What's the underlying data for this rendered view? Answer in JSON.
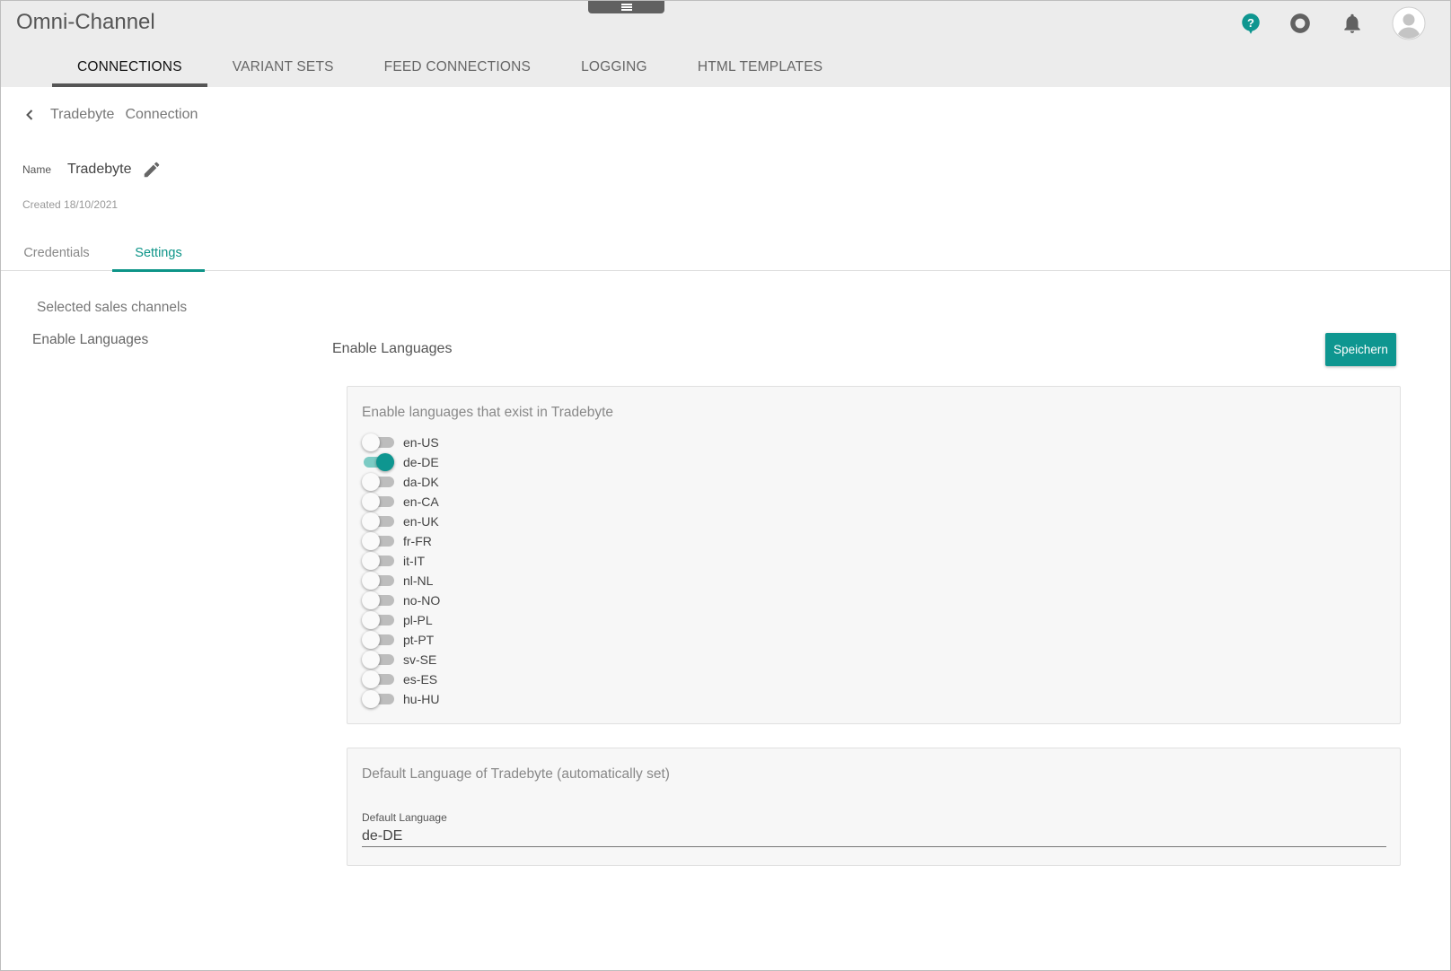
{
  "app": {
    "title": "Omni-Channel"
  },
  "header": {
    "icons": [
      "help-icon",
      "status-icon",
      "bell-icon",
      "avatar"
    ],
    "tabs": [
      {
        "label": "CONNECTIONS",
        "active": true
      },
      {
        "label": "VARIANT SETS",
        "active": false
      },
      {
        "label": "FEED CONNECTIONS",
        "active": false
      },
      {
        "label": "LOGGING",
        "active": false
      },
      {
        "label": "HTML TEMPLATES",
        "active": false
      }
    ]
  },
  "breadcrumb": {
    "items": [
      "Tradebyte",
      "Connection"
    ]
  },
  "record": {
    "name_label": "Name",
    "name_value": "Tradebyte",
    "created": "Created 18/10/2021"
  },
  "subtabs": [
    {
      "label": "Credentials",
      "active": false
    },
    {
      "label": "Settings",
      "active": true
    }
  ],
  "sidenav": {
    "items": [
      {
        "label": "Selected sales channels",
        "active": false
      },
      {
        "label": "Enable Languages",
        "active": true
      }
    ]
  },
  "main": {
    "title": "Enable Languages",
    "save_label": "Speichern",
    "languages_card": {
      "title": "Enable languages that exist in Tradebyte",
      "languages": [
        {
          "code": "en-US",
          "enabled": false
        },
        {
          "code": "de-DE",
          "enabled": true
        },
        {
          "code": "da-DK",
          "enabled": false
        },
        {
          "code": "en-CA",
          "enabled": false
        },
        {
          "code": "en-UK",
          "enabled": false
        },
        {
          "code": "fr-FR",
          "enabled": false
        },
        {
          "code": "it-IT",
          "enabled": false
        },
        {
          "code": "nl-NL",
          "enabled": false
        },
        {
          "code": "no-NO",
          "enabled": false
        },
        {
          "code": "pl-PL",
          "enabled": false
        },
        {
          "code": "pt-PT",
          "enabled": false
        },
        {
          "code": "sv-SE",
          "enabled": false
        },
        {
          "code": "es-ES",
          "enabled": false
        },
        {
          "code": "hu-HU",
          "enabled": false
        }
      ]
    },
    "default_card": {
      "title": "Default Language of Tradebyte (automatically set)",
      "field_label": "Default Language",
      "field_value": "de-DE"
    }
  },
  "colors": {
    "accent": "#0e9690",
    "header_bg": "#ececec"
  }
}
